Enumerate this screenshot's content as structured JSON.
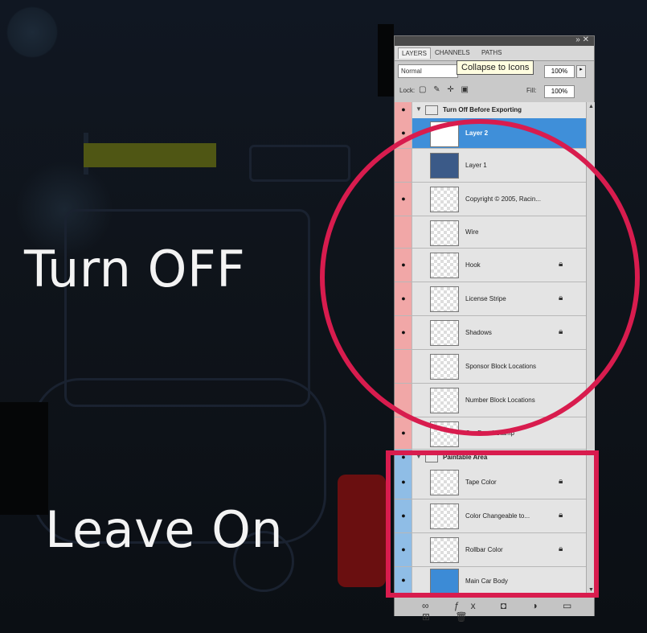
{
  "overlay": {
    "turn_off": "Turn OFF",
    "leave_on": "Leave On"
  },
  "panel": {
    "tabs": [
      {
        "label": "LAYERS",
        "active": true
      },
      {
        "label": "CHANNELS",
        "active": false
      },
      {
        "label": "PATHS",
        "active": false
      }
    ],
    "tooltip": "Collapse to Icons",
    "blend_mode": "Normal",
    "opacity": "100%",
    "lock_label": "Lock:",
    "fill_label": "Fill:",
    "fill": "100%"
  },
  "layers": [
    {
      "name": "Turn Off Before Exporting",
      "type": "group",
      "visible": true,
      "highlight": "red"
    },
    {
      "name": "Layer 2",
      "visible": true,
      "selected": true,
      "highlight": "red"
    },
    {
      "name": "Layer 1",
      "visible": false,
      "highlight": "red"
    },
    {
      "name": "Copyright © 2005, Racin...",
      "visible": true,
      "highlight": "red"
    },
    {
      "name": "Wire",
      "visible": false,
      "highlight": "red"
    },
    {
      "name": "Hook",
      "visible": true,
      "locked": true,
      "highlight": "red"
    },
    {
      "name": "License Stripe",
      "visible": true,
      "locked": true,
      "highlight": "red"
    },
    {
      "name": "Shadows",
      "visible": true,
      "locked": true,
      "highlight": "red"
    },
    {
      "name": "Sponsor Block Locations",
      "visible": false,
      "highlight": "red"
    },
    {
      "name": "Number Block Locations",
      "visible": false,
      "highlight": "red"
    },
    {
      "name": "Car Decal Stamp",
      "visible": true,
      "highlight": "red"
    },
    {
      "name": "Paintable Area",
      "type": "group",
      "visible": true,
      "highlight": "blue"
    },
    {
      "name": "Tape Color",
      "visible": true,
      "locked": true,
      "highlight": "blue"
    },
    {
      "name": "Color Changeable to...",
      "visible": true,
      "locked": true,
      "highlight": "blue"
    },
    {
      "name": "Rollbar Color",
      "visible": true,
      "locked": true,
      "highlight": "blue"
    },
    {
      "name": "Main Car Body",
      "visible": true,
      "highlight": "blue"
    }
  ],
  "colors": {
    "annotation": "#d81c4e",
    "selected": "#3f8fd9",
    "off_highlight": "#f1a7a7",
    "on_highlight": "#8fbde6"
  }
}
